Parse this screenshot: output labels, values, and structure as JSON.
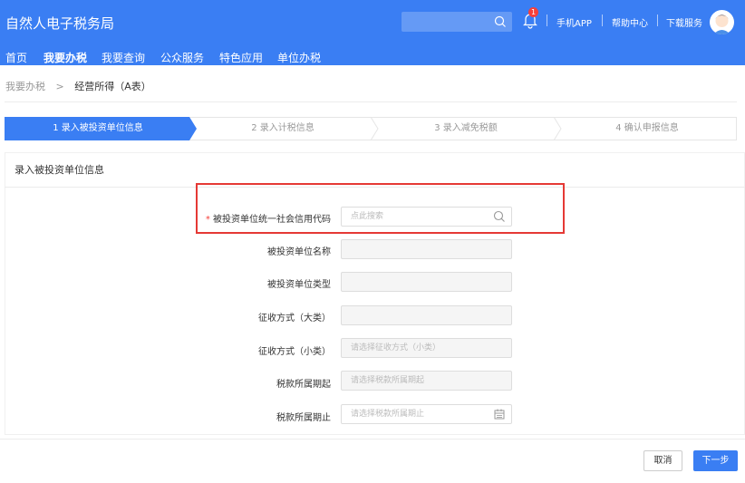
{
  "header": {
    "title": "自然人电子税务局",
    "search_icon": "search-icon",
    "notification_count": "1",
    "links": [
      "手机APP",
      "帮助中心",
      "下载服务"
    ]
  },
  "nav": {
    "items": [
      "首页",
      "我要办税",
      "我要查询",
      "公众服务",
      "特色应用",
      "单位办税"
    ],
    "active": "我要办税"
  },
  "breadcrumb": {
    "parent": "我要办税",
    "separator": ">",
    "current": "经营所得（A表）"
  },
  "steps": [
    "1  录入被投资单位信息",
    "2  录入计税信息",
    "3  录入减免税额",
    "4  确认申报信息"
  ],
  "section": {
    "title": "录入被投资单位信息"
  },
  "form": {
    "fields": [
      {
        "label": "被投资单位统一社会信用代码",
        "required": "*",
        "placeholder": "点此搜索"
      },
      {
        "label": "被投资单位名称",
        "placeholder": ""
      },
      {
        "label": "被投资单位类型",
        "placeholder": ""
      },
      {
        "label": "征收方式（大类）",
        "placeholder": ""
      },
      {
        "label": "征收方式（小类）",
        "placeholder": "请选择征收方式（小类）"
      },
      {
        "label": "税款所属期起",
        "placeholder": "请选择税款所属期起"
      },
      {
        "label": "税款所属期止",
        "placeholder": "请选择税款所属期止"
      }
    ]
  },
  "footer": {
    "cancel_label": "取消",
    "next_label": "下一步"
  },
  "colors": {
    "primary": "#3a7ef3",
    "highlight": "#e53935"
  }
}
